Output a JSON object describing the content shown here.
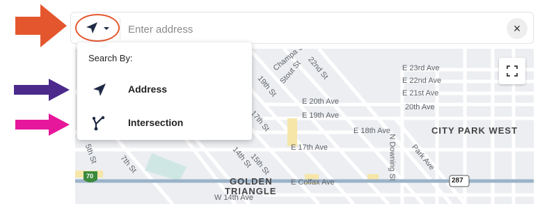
{
  "search": {
    "placeholder": "Enter address",
    "clear_label": "×",
    "mode_icon": "navigation-arrow-icon",
    "mode_caret": "chevron-down-icon"
  },
  "dropdown": {
    "title": "Search By:",
    "items": [
      {
        "label": "Address",
        "icon": "navigation-arrow-icon"
      },
      {
        "label": "Intersection",
        "icon": "fork-icon"
      }
    ]
  },
  "map": {
    "labels": [
      "E 23rd Ave",
      "E 22nd Ave",
      "E 21st Ave",
      "20th Ave",
      "E 20th Ave",
      "E 19th Ave",
      "E 18th Ave",
      "CITY PARK WEST",
      "E 17th Ave",
      "GOLDEN",
      "TRIANGLE",
      "E Colfax Ave",
      "W 14th Ave",
      "Champa St",
      "Stout St",
      "22nd St",
      "19th St",
      "17th St",
      "15th St",
      "14th St",
      "7th St",
      "5th St",
      "N Downing St",
      "Park Ave",
      "70",
      "287"
    ]
  },
  "annotations": {
    "orange": "#e4572e",
    "purple": "#4b2a8c",
    "pink": "#e6179a"
  }
}
